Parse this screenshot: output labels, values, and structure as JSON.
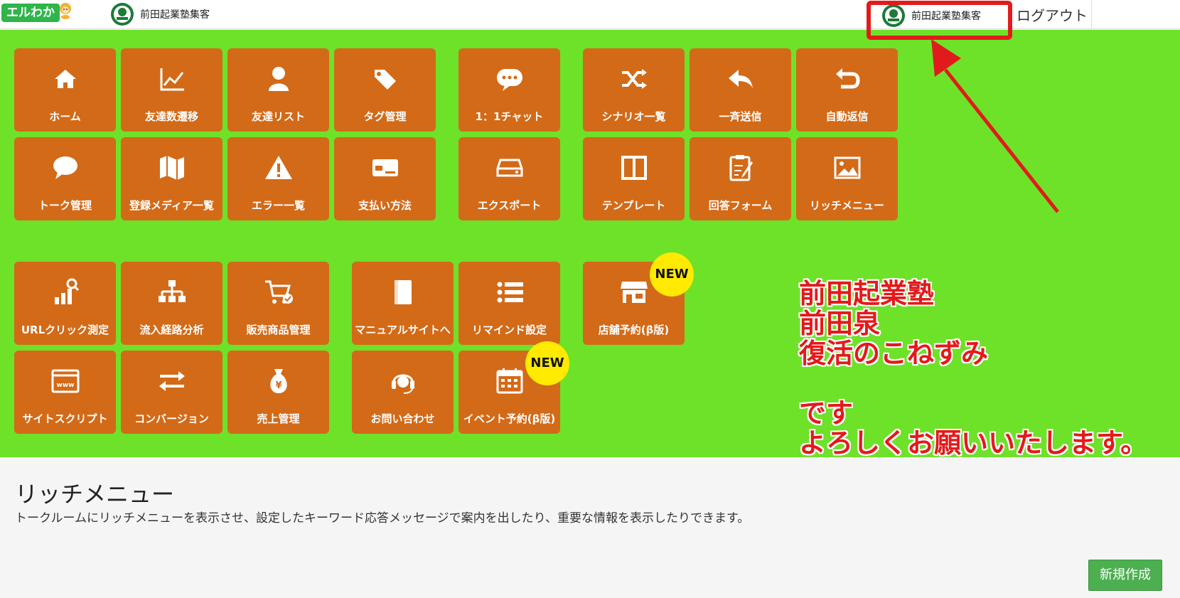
{
  "header": {
    "logo_text": "エルわか",
    "account_left": "前田起業塾集客",
    "account_right": "前田起業塾集客",
    "logout": "ログアウト"
  },
  "tiles": {
    "home": "ホーム",
    "friends_trend": "友達数遷移",
    "friends_list": "友達リスト",
    "tags": "タグ管理",
    "chat": "1：1チャット",
    "scenario": "シナリオ一覧",
    "broadcast": "一斉送信",
    "autoreply": "自動返信",
    "talk": "トーク管理",
    "media": "登録メディア一覧",
    "errors": "エラー一覧",
    "payment": "支払い方法",
    "export": "エクスポート",
    "template": "テンプレート",
    "form": "回答フォーム",
    "richmenu": "リッチメニュー",
    "urlclick": "URLクリック測定",
    "inflow": "流入経路分析",
    "products": "販売商品管理",
    "manual": "マニュアルサイトへ",
    "remind": "リマインド設定",
    "store": "店舗予約(β版)",
    "sitescript": "サイトスクリプト",
    "conversion": "コンバージョン",
    "sales": "売上管理",
    "contact": "お問い合わせ",
    "event": "イベント予約(β版)"
  },
  "badges": {
    "new": "NEW"
  },
  "note": "前田起業塾\n前田泉\n復活のこねずみ\n\nです\nよろしくお願いいたします。",
  "section": {
    "title": "リッチメニュー",
    "description": "トークルームにリッチメニューを表示させ、設定したキーワード応答メッセージで案内を出したり、重要な情報を表示したりできます。",
    "new_button": "新規作成"
  },
  "colors": {
    "panel": "#6ee129",
    "tile": "#d36a18",
    "badge": "#ffea00",
    "annotation": "#e11b1b",
    "button": "#4caf50"
  }
}
